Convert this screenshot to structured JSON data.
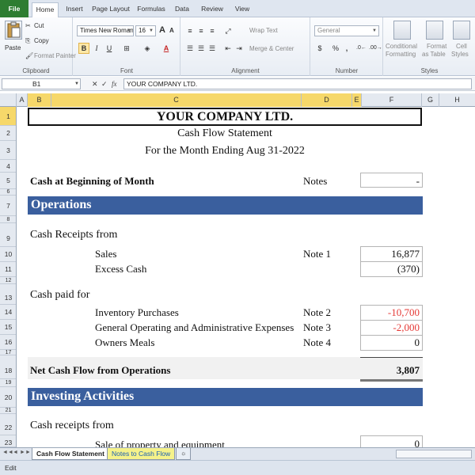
{
  "ribbon_tabs": [
    "File",
    "Home",
    "Insert",
    "Page Layout",
    "Formulas",
    "Data",
    "Review",
    "View"
  ],
  "clipboard": {
    "paste": "Paste",
    "cut": "Cut",
    "copy": "Copy",
    "format_painter": "Format Painter",
    "label": "Clipboard"
  },
  "font": {
    "name": "Times New Roman",
    "size": "16",
    "label": "Font",
    "grow": "A",
    "shrink": "A",
    "bold": "B",
    "italic": "I",
    "underline": "U"
  },
  "alignment": {
    "wrap_text": "Wrap Text",
    "merge_center": "Merge & Center",
    "label": "Alignment"
  },
  "number": {
    "format": "General",
    "percent": "%",
    "comma": ",",
    "label": "Number"
  },
  "styles": {
    "conditional": [
      "Conditional",
      "Formatting"
    ],
    "format_table": [
      "Format",
      "as Table"
    ],
    "cell_styles": [
      "Cell",
      "Styles"
    ],
    "label": "Styles"
  },
  "formula_bar": {
    "name_box": "B1",
    "cancel": "✕",
    "enter": "✓",
    "fx": "fx",
    "formula": "YOUR COMPANY LTD."
  },
  "columns": [
    "A",
    "B",
    "C",
    "D",
    "E",
    "F",
    "G",
    "H"
  ],
  "rows": [
    "1",
    "2",
    "3",
    "4",
    "5",
    "6",
    "7",
    "8",
    "9",
    "10",
    "11",
    "12",
    "13",
    "14",
    "15",
    "16",
    "17",
    "18",
    "19",
    "20",
    "21",
    "22",
    "23"
  ],
  "sheet": {
    "company": "YOUR COMPANY LTD.",
    "statement_title": "Cash Flow Statement",
    "period": "For the Month Ending Aug 31-2022",
    "cash_begin_label": "Cash at Beginning of Month",
    "notes_header": "Notes",
    "cash_begin_value": "-",
    "operations_band": "Operations",
    "cash_receipts_from": "Cash Receipts from",
    "sales": "Sales",
    "sales_note": "Note 1",
    "sales_value": "16,877",
    "excess_cash": "Excess Cash",
    "excess_cash_value": "(370)",
    "cash_paid_for": "Cash paid for",
    "inventory": "Inventory Purchases",
    "inventory_note": "Note 2",
    "inventory_value": "-10,700",
    "general_ops": "General Operating and Administrative Expenses",
    "general_ops_note": "Note 3",
    "general_ops_value": "-2,000",
    "owners_meals": "Owners Meals",
    "owners_meals_note": "Note 4",
    "owners_meals_value": "0",
    "net_ops_label": "Net Cash Flow from Operations",
    "net_ops_value": "3,807",
    "investing_band": "Investing Activities",
    "cash_receipts_from_2": "Cash receipts from",
    "sale_property": "Sale of property and equipment",
    "sale_property_value": "0"
  },
  "sheet_tabs": [
    "Cash Flow Statement",
    "Notes to Cash Flow"
  ],
  "status": "Edit",
  "colors": {
    "file_tab": "#2e7d32",
    "band": "#3a5f9e",
    "negative": "#e53935",
    "selected_header": "#f6d86a"
  }
}
